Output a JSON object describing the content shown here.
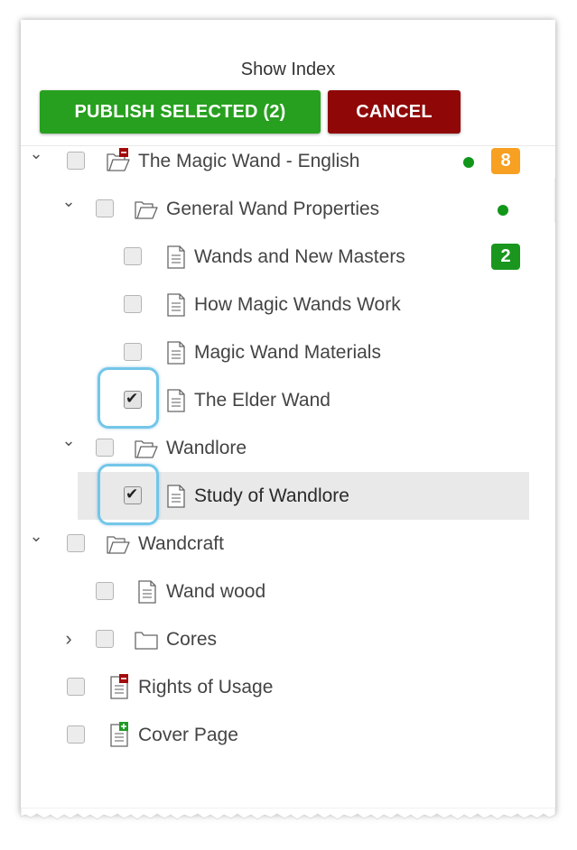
{
  "header": {
    "title": "Show Index",
    "publish_label": "PUBLISH SELECTED (2)",
    "cancel_label": "CANCEL"
  },
  "colors": {
    "publish": "#27a01f",
    "cancel": "#8f0707",
    "status_dot": "#11961a",
    "badge_orange": "#f7a021",
    "badge_green": "#1a961f",
    "focus_ring": "#73c6e8"
  },
  "tree": [
    {
      "label": "The Magic Wand - English",
      "type": "folder",
      "icon": "folder-open-remove-icon",
      "expanded": true,
      "checked": false,
      "dot": true,
      "badge": "8",
      "badge_color": "orange"
    },
    {
      "label": "General Wand Properties",
      "type": "folder",
      "icon": "folder-open-icon",
      "expanded": true,
      "checked": false,
      "dot": true
    },
    {
      "label": "Wands and New Masters",
      "type": "document",
      "icon": "document-icon",
      "checked": false,
      "badge": "2",
      "badge_color": "green"
    },
    {
      "label": "How Magic Wands Work",
      "type": "document",
      "icon": "document-icon",
      "checked": false
    },
    {
      "label": "Magic Wand Materials",
      "type": "document",
      "icon": "document-icon",
      "checked": false
    },
    {
      "label": "The Elder Wand",
      "type": "document",
      "icon": "document-icon",
      "checked": true,
      "focused": true
    },
    {
      "label": "Wandlore",
      "type": "folder",
      "icon": "folder-open-icon",
      "expanded": true,
      "checked": false
    },
    {
      "label": "Study of Wandlore",
      "type": "document",
      "icon": "document-icon",
      "checked": true,
      "focused": true,
      "selected": true
    },
    {
      "label": "Wandcraft",
      "type": "folder",
      "icon": "folder-open-icon",
      "expanded": true,
      "checked": false
    },
    {
      "label": "Wand wood",
      "type": "document",
      "icon": "document-icon",
      "checked": false
    },
    {
      "label": "Cores",
      "type": "folder",
      "icon": "folder-closed-icon",
      "expanded": false,
      "checked": false
    },
    {
      "label": "Rights of Usage",
      "type": "document",
      "icon": "document-remove-icon",
      "checked": false
    },
    {
      "label": "Cover Page",
      "type": "document",
      "icon": "document-add-icon",
      "checked": false
    }
  ]
}
